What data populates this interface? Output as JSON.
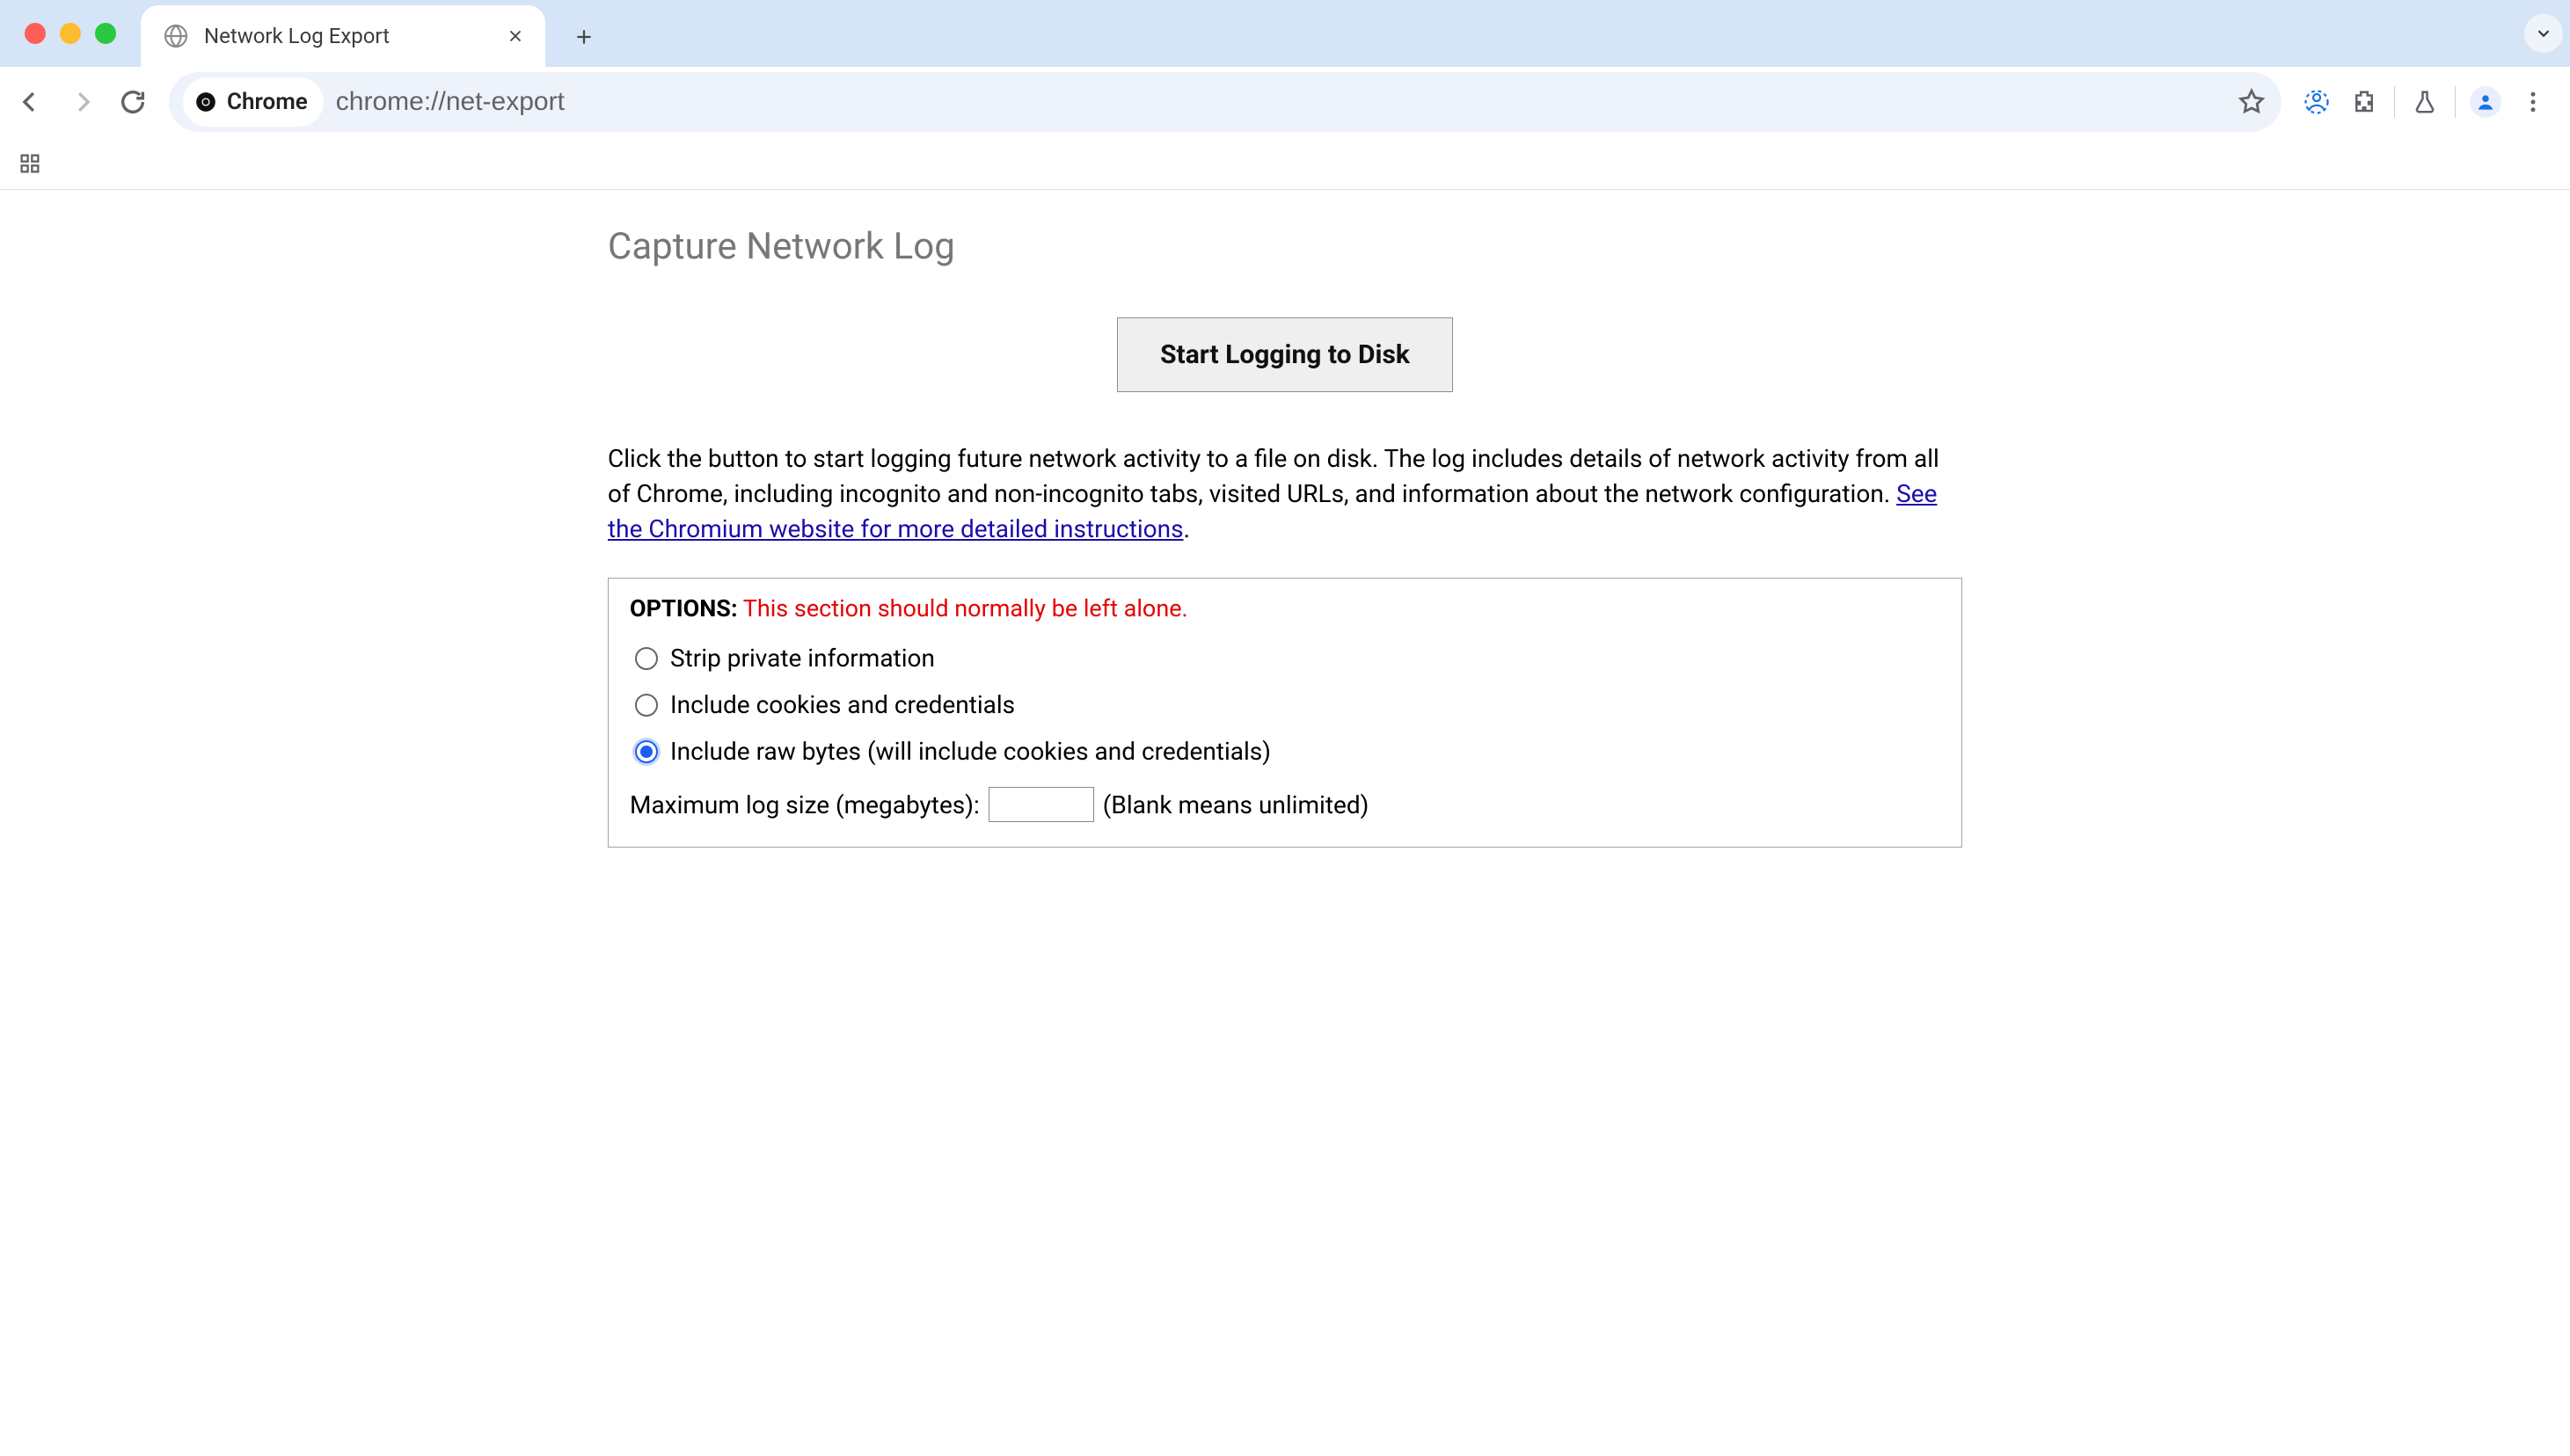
{
  "browser": {
    "tab_title": "Network Log Export",
    "omnibox_chip": "Chrome",
    "url_display": "chrome://net-export"
  },
  "page": {
    "title": "Capture Network Log",
    "start_button": "Start Logging to Disk",
    "description_part1": "Click the button to start logging future network activity to a file on disk. The log includes details of network activity from all of Chrome, including incognito and non-incognito tabs, visited URLs, and information about the network configuration. ",
    "description_link": "See the Chromium website for more detailed instructions",
    "description_part2": "."
  },
  "options": {
    "header_label": "OPTIONS",
    "header_warning": "This section should normally be left alone.",
    "radio_items": [
      {
        "label": "Strip private information",
        "checked": false
      },
      {
        "label": "Include cookies and credentials",
        "checked": false
      },
      {
        "label": "Include raw bytes (will include cookies and credentials)",
        "checked": true
      }
    ],
    "log_size_label": "Maximum log size (megabytes):",
    "log_size_value": "",
    "log_size_suffix": "(Blank means unlimited)"
  }
}
